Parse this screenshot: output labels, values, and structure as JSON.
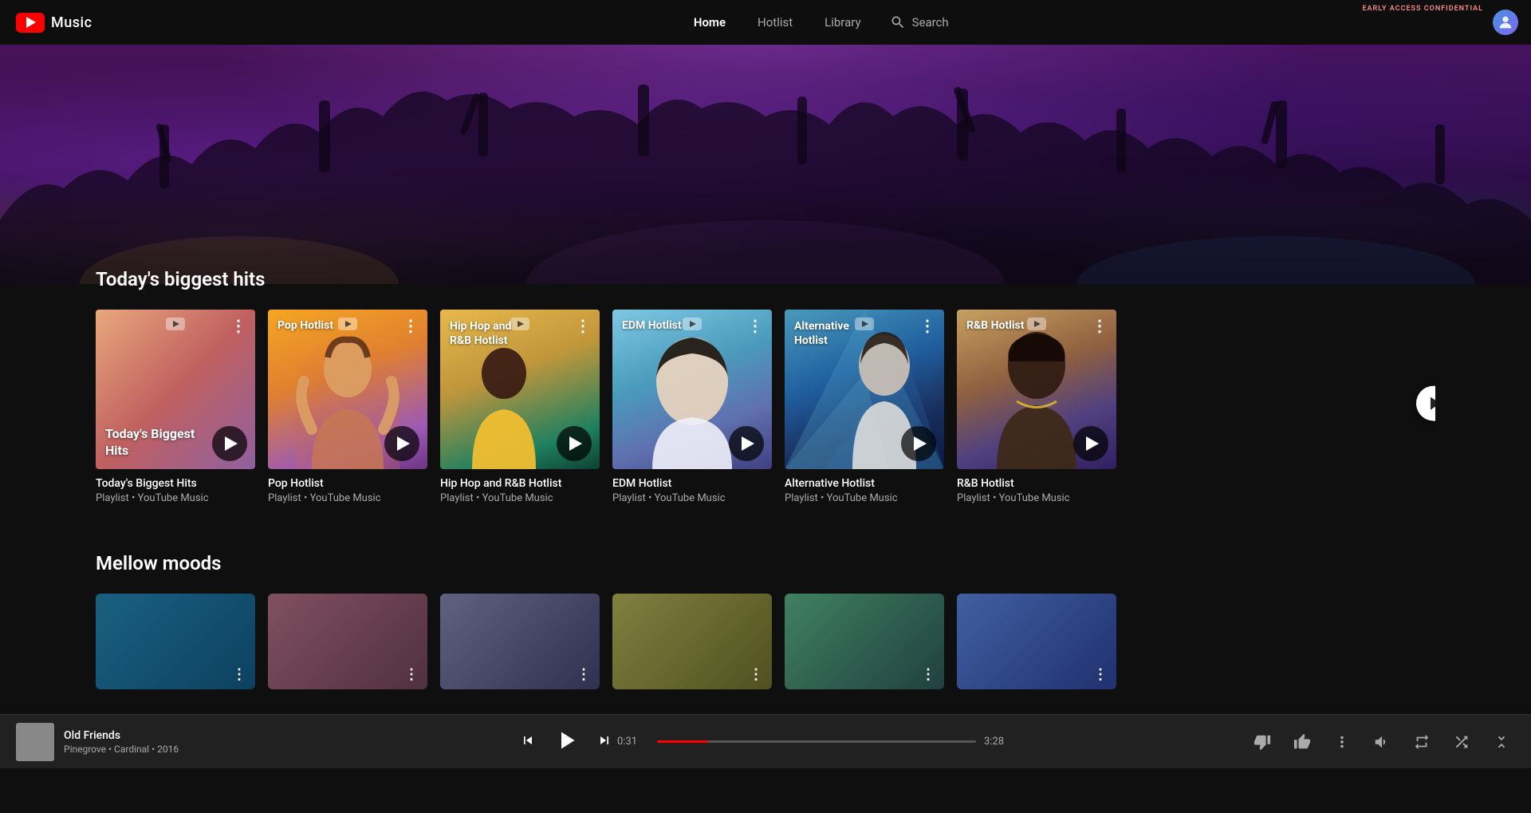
{
  "app": {
    "name": "Music",
    "early_access_label": "EARLY ACCESS CONFIDENTIAL"
  },
  "navbar": {
    "logo_alt": "YouTube Music",
    "nav_items": [
      {
        "id": "home",
        "label": "Home",
        "active": true
      },
      {
        "id": "hotlist",
        "label": "Hotlist",
        "active": false
      },
      {
        "id": "library",
        "label": "Library",
        "active": false
      }
    ],
    "search_label": "Search"
  },
  "hero": {
    "gradient": "crowd concert"
  },
  "sections": [
    {
      "id": "biggest-hits",
      "title": "Today's biggest hits",
      "cards": [
        {
          "id": "todays-biggest-hits",
          "title": "Today's Biggest Hits",
          "subtitle": "Playlist • YouTube Music",
          "thumb_label": "Today's Biggest Hits",
          "bg_class": "bg-biggest-hits"
        },
        {
          "id": "pop-hotlist",
          "title": "Pop Hotlist",
          "subtitle": "Playlist • YouTube Music",
          "thumb_label": "Pop Hotlist",
          "bg_class": "bg-pop"
        },
        {
          "id": "hiphop-rnb-hotlist",
          "title": "Hip Hop and R&B Hotlist",
          "subtitle": "Playlist • YouTube Music",
          "thumb_label": "Hip Hop and R&B Hotlist",
          "bg_class": "bg-hiphop"
        },
        {
          "id": "edm-hotlist",
          "title": "EDM Hotlist",
          "subtitle": "Playlist • YouTube Music",
          "thumb_label": "EDM Hotlist",
          "bg_class": "bg-edm"
        },
        {
          "id": "alternative-hotlist",
          "title": "Alternative Hotlist",
          "subtitle": "Playlist • YouTube Music",
          "thumb_label": "Alternative Hotlist",
          "bg_class": "bg-alternative"
        },
        {
          "id": "rnb-hotlist",
          "title": "R&B Hotlist",
          "subtitle": "Playlist • YouTube Music",
          "thumb_label": "R&B Hotlist",
          "bg_class": "bg-rnb"
        }
      ]
    }
  ],
  "mellow_section": {
    "title": "Mellow moods",
    "cards": [
      {
        "id": "mellow-1",
        "bg_class": "mellow-bg-1"
      },
      {
        "id": "mellow-2",
        "bg_class": "mellow-bg-2"
      },
      {
        "id": "mellow-3",
        "bg_class": "mellow-bg-3"
      },
      {
        "id": "mellow-4",
        "bg_class": "mellow-bg-4"
      },
      {
        "id": "mellow-5",
        "bg_class": "mellow-bg-5"
      },
      {
        "id": "mellow-6",
        "bg_class": "mellow-bg-6"
      }
    ]
  },
  "player": {
    "song_title": "Old Friends",
    "artist": "Pinegrove",
    "album": "Cardinal",
    "year": "2016",
    "time_current": "0:31",
    "time_total": "3:28",
    "progress_pct": 16,
    "thumb_bg": "#666",
    "controls": {
      "skip_back_label": "Skip back",
      "play_label": "Play",
      "skip_fwd_label": "Skip forward"
    },
    "actions": {
      "thumb_down_label": "Dislike",
      "thumb_up_label": "Like",
      "more_label": "More options",
      "volume_label": "Volume",
      "repeat_label": "Repeat",
      "shuffle_label": "Shuffle",
      "expand_label": "Expand"
    }
  }
}
